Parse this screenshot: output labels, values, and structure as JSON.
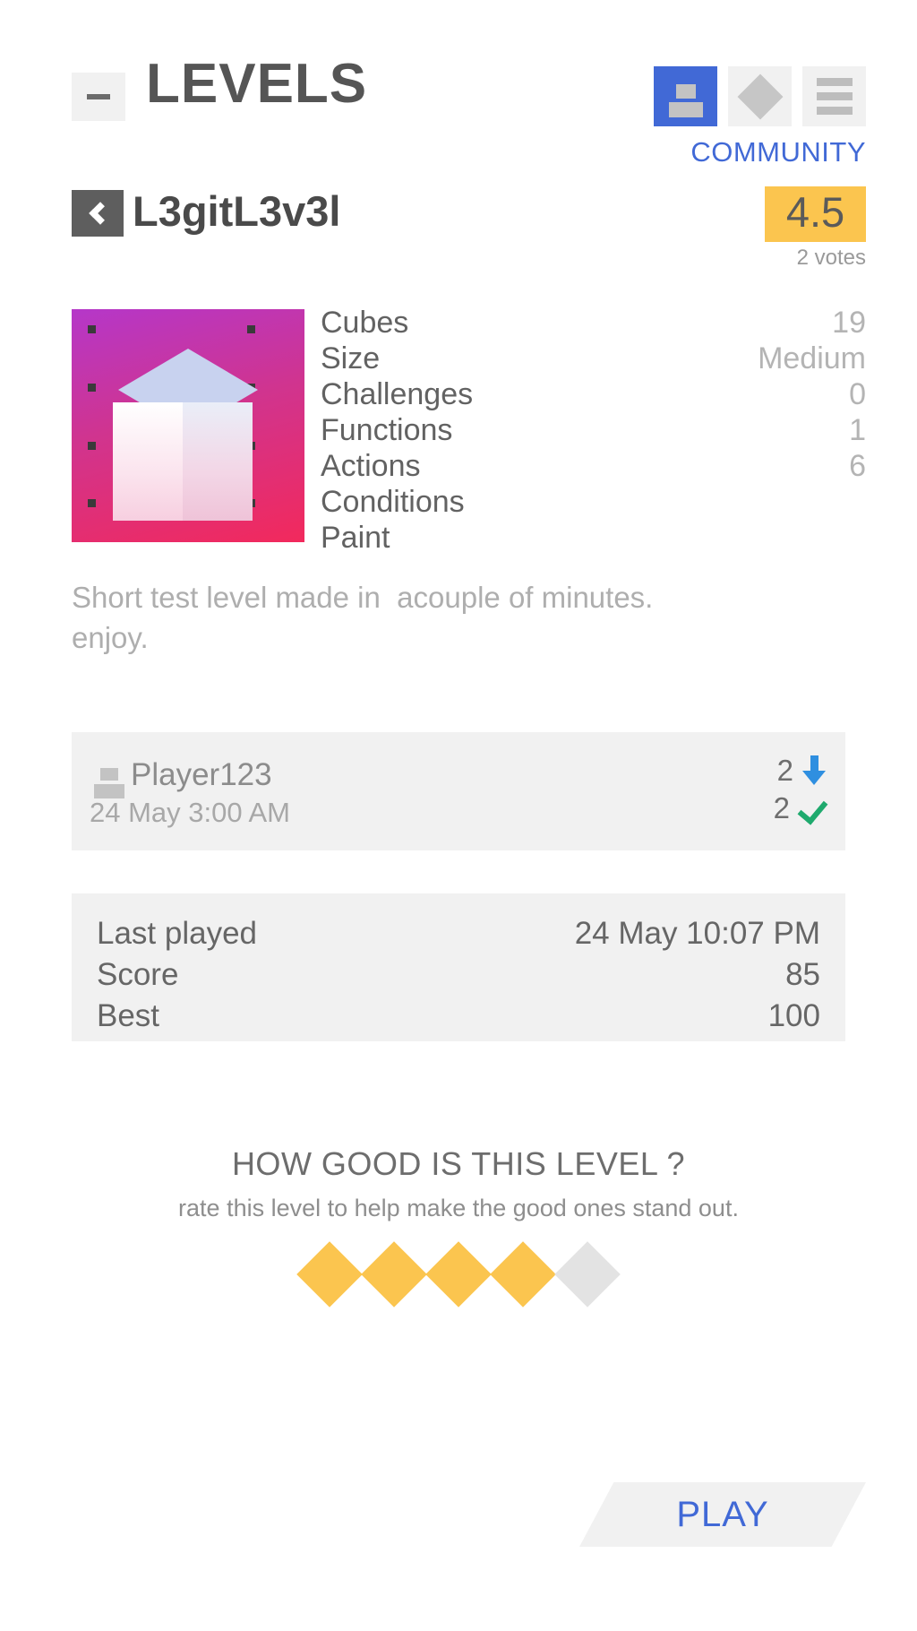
{
  "header": {
    "minus_button": "−",
    "title": "LEVELS",
    "buttons": [
      {
        "name": "user-levels",
        "icon": "user-icon",
        "active": true
      },
      {
        "name": "diamond-levels",
        "icon": "diamond-icon",
        "active": false
      },
      {
        "name": "menu",
        "icon": "hamburger-icon",
        "active": false
      }
    ],
    "community_label": "COMMUNITY",
    "accent_color": "#4169d6"
  },
  "level": {
    "back_label": "‹",
    "name": "L3gitL3v3l",
    "rating": "4.5",
    "votes": "2 votes",
    "rating_badge_color": "#fbc54f",
    "description": "Short test level made in  acouple of minutes.\nenjoy.",
    "stats": [
      {
        "label": "Cubes",
        "value": "19"
      },
      {
        "label": "Size",
        "value": "Medium"
      },
      {
        "label": "Challenges",
        "value": "0"
      },
      {
        "label": "Functions",
        "value": "1"
      },
      {
        "label": "Actions",
        "value": "6"
      },
      {
        "label": "Conditions",
        "value": ""
      },
      {
        "label": "Paint",
        "value": ""
      }
    ]
  },
  "author": {
    "name": "Player123",
    "date": "24 May 3:00 AM",
    "downloads": "2",
    "completions": "2",
    "download_icon_color": "#2f8fe0",
    "check_icon_color": "#1faa6e"
  },
  "progress": [
    {
      "label": "Last played",
      "value": "24 May 10:07 PM"
    },
    {
      "label": "Score",
      "value": "85"
    },
    {
      "label": "Best",
      "value": "100"
    }
  ],
  "rating_section": {
    "title": "HOW GOOD IS THIS LEVEL ?",
    "subtitle": "rate this level to help make the good ones stand out.",
    "stars_total": 5,
    "stars_filled": 4,
    "star_color": "#fbc54f",
    "star_empty_color": "#e3e3e3"
  },
  "footer": {
    "play_label": "PLAY"
  }
}
